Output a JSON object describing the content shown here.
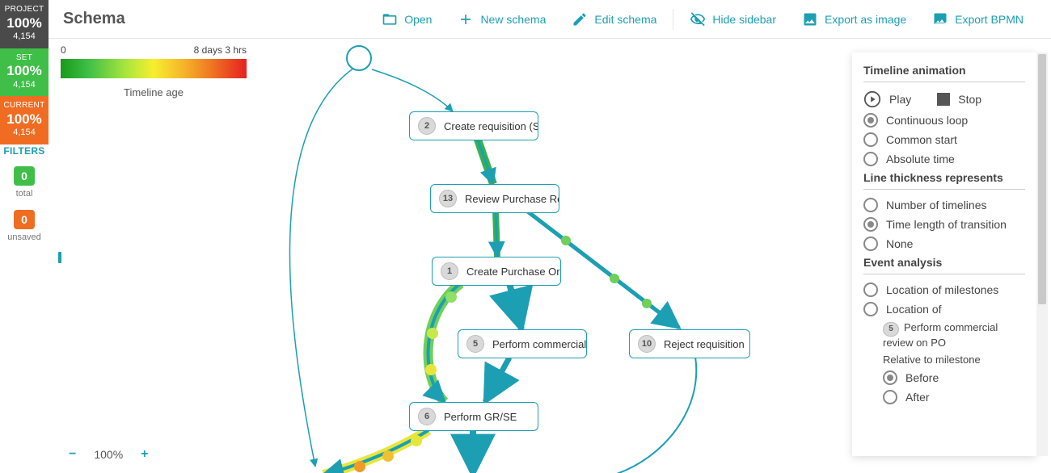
{
  "left_strip": {
    "project": {
      "title": "PROJECT",
      "pct": "100%",
      "count": "4,154"
    },
    "set": {
      "title": "SET",
      "pct": "100%",
      "count": "4,154"
    },
    "current": {
      "title": "CURRENT",
      "pct": "100%",
      "count": "4,154"
    }
  },
  "filters": {
    "title": "FILTERS",
    "total": {
      "n": "0",
      "label": "total"
    },
    "unsaved": {
      "n": "0",
      "label": "unsaved"
    }
  },
  "toolbar": {
    "title": "Schema",
    "open": "Open",
    "new": "New schema",
    "edit": "Edit schema",
    "hide": "Hide sidebar",
    "export_img": "Export as image",
    "export_bpmn": "Export BPMN"
  },
  "legend": {
    "min": "0",
    "max": "8 days 3 hrs",
    "caption": "Timeline age"
  },
  "nodes": {
    "n1": {
      "num": "2",
      "label": "Create requisition (SC)"
    },
    "n2": {
      "num": "13",
      "label": "Review Purchase Re..."
    },
    "n3": {
      "num": "1",
      "label": "Create Purchase Order"
    },
    "n4": {
      "num": "5",
      "label": "Perform commercial ..."
    },
    "n5": {
      "num": "10",
      "label": "Reject requisition"
    },
    "n6": {
      "num": "6",
      "label": "Perform GR/SE"
    }
  },
  "zoom": {
    "pct": "100%"
  },
  "panel": {
    "timeline_h": "Timeline animation",
    "play": "Play",
    "stop": "Stop",
    "loop": "Continuous loop",
    "common": "Common start",
    "absolute": "Absolute time",
    "thick_h": "Line thickness represents",
    "thick_num": "Number of timelines",
    "thick_time": "Time length of transition",
    "thick_none": "None",
    "event_h": "Event analysis",
    "ev_loc": "Location of milestones",
    "ev_locof": "Location of",
    "ev_pill": "5",
    "ev_text": "Perform commercial review on PO",
    "ev_rel": "Relative to milestone",
    "ev_before": "Before",
    "ev_after": "After"
  }
}
